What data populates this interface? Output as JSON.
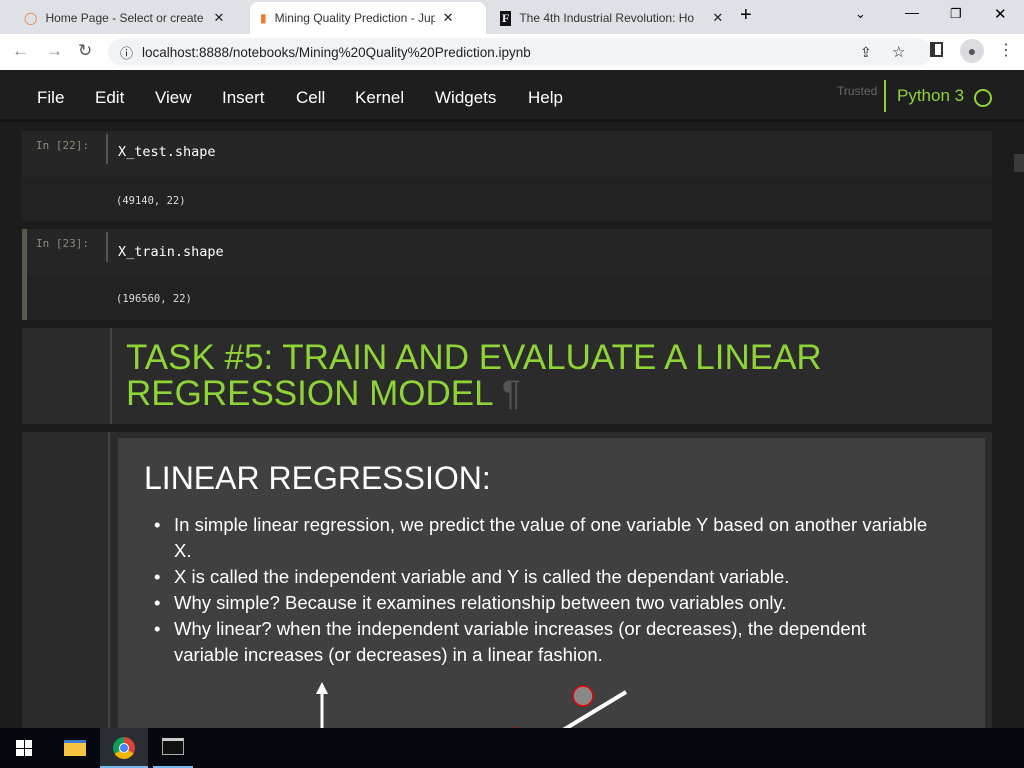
{
  "browser": {
    "tabs": [
      {
        "title": "Home Page - Select or create a n"
      },
      {
        "title": "Mining Quality Prediction - Jupyt"
      },
      {
        "title": "The 4th Industrial Revolution: Ho"
      }
    ],
    "url": "localhost:8888/notebooks/Mining%20Quality%20Prediction.ipynb"
  },
  "menu": {
    "items": [
      "File",
      "Edit",
      "View",
      "Insert",
      "Cell",
      "Kernel",
      "Widgets",
      "Help"
    ],
    "trusted": "Trusted",
    "kernel": "Python 3"
  },
  "cells": [
    {
      "prompt": "In [22]:",
      "code": "X_test.shape",
      "output": "(49140, 22)"
    },
    {
      "prompt": "In [23]:",
      "code": "X_train.shape",
      "output": "(196560, 22)"
    }
  ],
  "markdown": {
    "heading": "TASK #5: TRAIN AND EVALUATE A LINEAR REGRESSION MODEL",
    "pilcrow": "¶"
  },
  "slide": {
    "title": "LINEAR REGRESSION:",
    "bullets": [
      "In simple linear regression, we predict the value of one variable Y based on another variable X.",
      "X is called the independent variable and Y is called the dependant variable.",
      "Why simple? Because it examines relationship between two variables only.",
      "Why linear? when the independent variable increases (or decreases), the dependent variable increases (or decreases) in a linear fashion."
    ]
  },
  "colors": {
    "accent": "#8fd437",
    "point_stroke": "#e00000"
  }
}
